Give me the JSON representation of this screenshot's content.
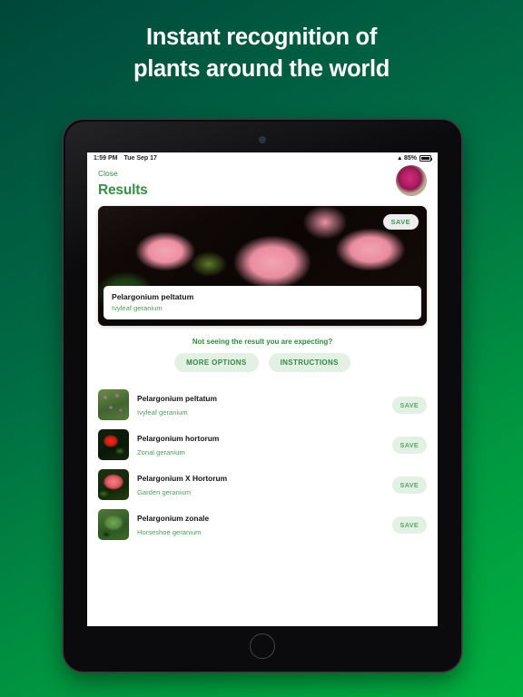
{
  "promo": {
    "line1": "Instant recognition of",
    "line2": "plants around the world"
  },
  "status_bar": {
    "time": "1:59 PM",
    "date": "Tue Sep 17",
    "wifi_icon": "wifi-icon",
    "battery_percent": "85%"
  },
  "app": {
    "close_label": "Close",
    "title": "Results",
    "avatar_name": "user-avatar-flower"
  },
  "hero": {
    "save_label": "SAVE",
    "scientific_name": "Pelargonium peltatum",
    "common_name": "Ivyleaf geranium",
    "photo_alt": "pink-geranium-flowers"
  },
  "helper": {
    "prompt": "Not seeing the result you are expecting?",
    "more_options_label": "MORE OPTIONS",
    "instructions_label": "INSTRUCTIONS"
  },
  "results": [
    {
      "scientific_name": "Pelargonium peltatum",
      "common_name": "Ivyleaf geranium",
      "save_label": "SAVE",
      "thumb": "t1"
    },
    {
      "scientific_name": "Pelargonium hortorum",
      "common_name": "Zonal geranium",
      "save_label": "SAVE",
      "thumb": "t2"
    },
    {
      "scientific_name": "Pelargonium X Hortorum",
      "common_name": "Garden geranium",
      "save_label": "SAVE",
      "thumb": "t3"
    },
    {
      "scientific_name": "Pelargonium zonale",
      "common_name": "Horseshoe geranium",
      "save_label": "SAVE",
      "thumb": "t4"
    }
  ],
  "colors": {
    "brand_green": "#2f8a3e",
    "accent_green": "#4fa05a",
    "pill_bg": "#e3f0e4",
    "bg_gradient_start": "#00473a",
    "bg_gradient_end": "#00b13f"
  }
}
